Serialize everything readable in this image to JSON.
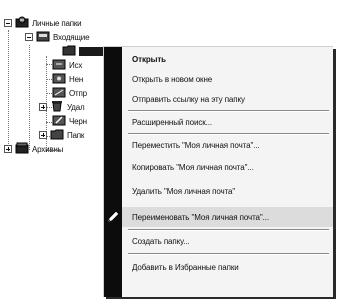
{
  "tree": {
    "root_label": "Личные папки",
    "inbox_label": "Входящие",
    "items": [
      {
        "label": "Исх"
      },
      {
        "label": "Нен"
      },
      {
        "label": "Отпр"
      },
      {
        "label": "Удал"
      },
      {
        "label": "Черн"
      },
      {
        "label": "Папк"
      }
    ],
    "archive_label": "Архивны"
  },
  "context_menu": {
    "items": [
      {
        "label": "Открыть"
      },
      {
        "label": "Открыть в новом окне"
      },
      {
        "label": "Отправить ссылку на эту папку"
      },
      {
        "label": "Расширенный поиск..."
      },
      {
        "label": "Переместить \"Моя личная почта\"..."
      },
      {
        "label": "Копировать \"Моя личная почта\"..."
      },
      {
        "label": "Удалить \"Моя личная почта\""
      },
      {
        "label": "Переименовать \"Моя личная почта\"..."
      },
      {
        "label": "Создать папку..."
      },
      {
        "label": "Добавить в Избранные папки"
      }
    ]
  },
  "colors": {
    "icon_strip": "#0c0c0c",
    "highlight": "#dcdcdc"
  }
}
